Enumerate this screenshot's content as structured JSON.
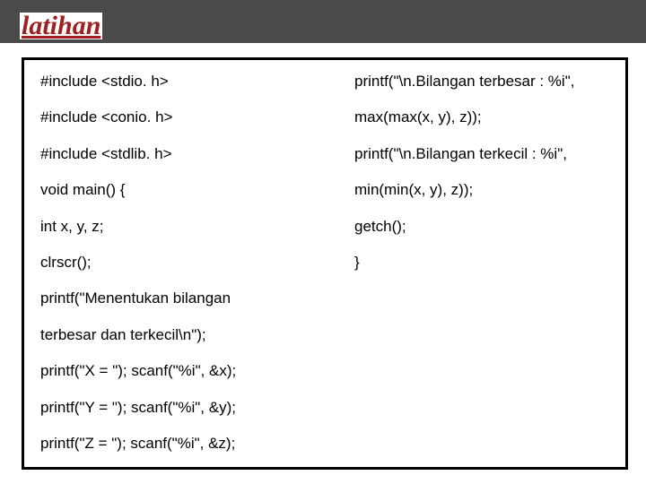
{
  "title": "latihan",
  "code": {
    "left": [
      "#include <stdio. h>",
      "#include <conio. h>",
      "#include <stdlib. h>",
      "void main() {",
      "int x, y, z;",
      "clrscr();",
      "printf(\"Menentukan bilangan",
      "terbesar dan terkecil\\n\");",
      "printf(\"X = \"); scanf(\"%i\", &x);",
      "printf(\"Y = \"); scanf(\"%i\", &y);",
      "printf(\"Z = \"); scanf(\"%i\", &z);"
    ],
    "right": [
      "printf(\"\\n.Bilangan terbesar : %i\",",
      "max(max(x, y), z));",
      " printf(\"\\n.Bilangan terkecil : %i\",",
      "min(min(x, y), z));",
      " getch();",
      " }"
    ]
  }
}
